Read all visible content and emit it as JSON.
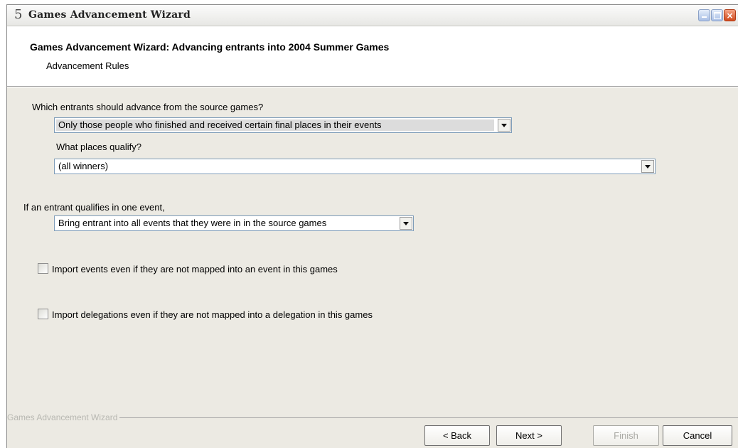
{
  "window": {
    "title": "Games Advancement Wizard",
    "app_icon_glyph": "5",
    "controls": {
      "minimize_icon": "minimize-icon",
      "maximize_icon": "maximize-icon",
      "close_icon": "close-icon",
      "close_glyph": "×"
    }
  },
  "header": {
    "heading": "Games Advancement Wizard: Advancing entrants into 2004 Summer Games",
    "subheading": "Advancement Rules"
  },
  "form": {
    "which_entrants": {
      "label": "Which entrants should advance from the source games?",
      "selected": "Only those people who finished and received certain final places in their events"
    },
    "what_places": {
      "label": "What places qualify?",
      "selected": "(all winners)"
    },
    "if_qualifies": {
      "label": "If an entrant qualifies in one event,",
      "selected": "Bring entrant into all events that they were in in the source games"
    },
    "import_events": {
      "label": "Import events even if they are not mapped into an event in this games",
      "checked": false
    },
    "import_delegations": {
      "label": "Import delegations even if they are not mapped into a delegation in this games",
      "checked": false
    }
  },
  "footer": {
    "group_caption": "Games Advancement Wizard",
    "back_label": "< Back",
    "next_label": "Next >",
    "finish_label": "Finish",
    "cancel_label": "Cancel"
  },
  "colors": {
    "panel_background": "#eceae3",
    "disabled_text": "#a9a9a4",
    "field_border": "#7f9db9"
  }
}
